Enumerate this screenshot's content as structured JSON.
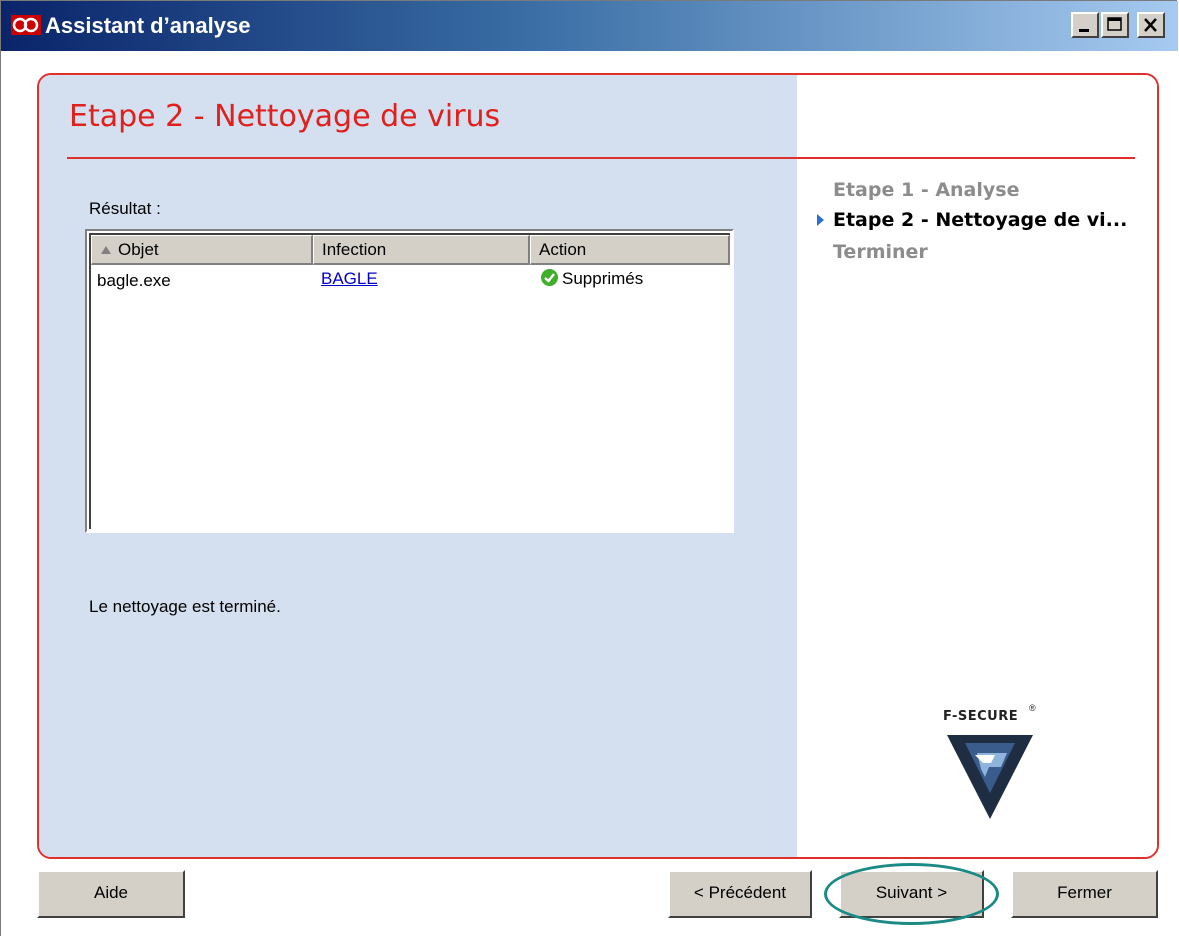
{
  "window": {
    "title": "Assistant d’analyse",
    "controls": [
      "minimize-icon",
      "maximize-icon",
      "close-icon"
    ]
  },
  "panel": {
    "heading": "Etape 2 - Nettoyage de virus",
    "result_label": "Résultat :",
    "table": {
      "columns": [
        "Objet",
        "Infection",
        "Action"
      ],
      "rows": [
        {
          "objet": "bagle.exe",
          "infection": "BAGLE",
          "action": "Supprimés"
        }
      ]
    },
    "status": "Le nettoyage est terminé."
  },
  "steps": [
    {
      "label": "Etape 1 - Analyse",
      "state": "done"
    },
    {
      "label": "Etape 2 - Nettoyage de vi...",
      "state": "current"
    },
    {
      "label": "Terminer",
      "state": "pending"
    }
  ],
  "logo": {
    "text": "F-SECURE",
    "mark": "®"
  },
  "buttons": {
    "help": "Aide",
    "previous": "< Précédent",
    "next": "Suivant >",
    "close": "Fermer"
  },
  "colors": {
    "accent": "#e0302c",
    "left_panel_bg": "#d4e0ef",
    "link": "#0000cc",
    "highlight": "#1b8a86",
    "step_done": "#8c8c8c",
    "step_current": "#000000",
    "step_pending": "#8c8c8c"
  }
}
